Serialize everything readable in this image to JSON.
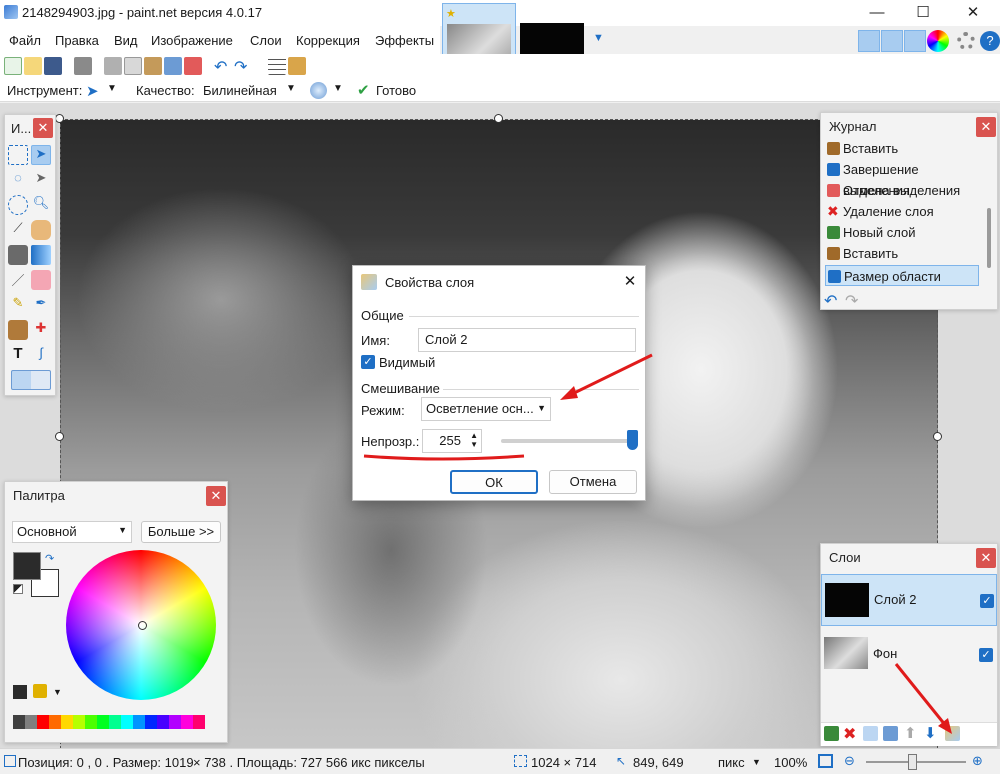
{
  "window": {
    "title": "2148294903.jpg - paint.net версия 4.0.17",
    "minimize": "—",
    "maximize": "☐",
    "close": "✕"
  },
  "menu": [
    "Файл",
    "Правка",
    "Вид",
    "Изображение",
    "Слои",
    "Коррекция",
    "Эффекты"
  ],
  "toolbar2": {
    "tool_label": "Инструмент:",
    "quality_label": "Качество:",
    "quality_value": "Билинейная",
    "done_label": "Готово"
  },
  "tools_panel": {
    "title": "И..."
  },
  "history": {
    "title": "Журнал",
    "items": [
      "Вставить",
      "Завершение выделения",
      "Отмена выделения",
      "Удаление слоя",
      "Новый слой",
      "Вставить",
      "Размер области"
    ],
    "selected_index": 6
  },
  "dialog": {
    "title": "Свойства слоя",
    "section_general": "Общие",
    "name_label": "Имя:",
    "name_value": "Слой 2",
    "visible_label": "Видимый",
    "section_blend": "Смешивание",
    "mode_label": "Режим:",
    "mode_value": "Осветление осн...",
    "opacity_label": "Непрозр.:",
    "opacity_value": "255",
    "ok_label": "ОК",
    "cancel_label": "Отмена"
  },
  "palette": {
    "title": "Палитра",
    "preset_value": "Основной",
    "more_label": "Больше >>",
    "primary_color": "#2b2b2b",
    "secondary_color": "#ffffff",
    "swatches": [
      "#404040",
      "#7f7f7f",
      "#ff0000",
      "#ff6a00",
      "#ffd800",
      "#b6ff00",
      "#4cff00",
      "#00ff21",
      "#00ff90",
      "#00ffff",
      "#0094ff",
      "#0026ff",
      "#4800ff",
      "#b200ff",
      "#ff00dc",
      "#ff006e"
    ]
  },
  "layers": {
    "title": "Слои",
    "items": [
      {
        "name": "Слой 2",
        "visible": true,
        "selected": true
      },
      {
        "name": "Фон",
        "visible": true,
        "selected": false
      }
    ]
  },
  "status": {
    "position": "Позиция: 0 , 0 . Размер: 1019 ",
    "size_rest": "× 738 . Площадь: 727 566 икс пикселы",
    "selection_size": "1024 × 714",
    "cursor_pos": "849, 649",
    "units": "пикс",
    "zoom": "100%"
  },
  "colors": {
    "accent": "#1f6fc5",
    "close_red": "#d9534f",
    "annotation_red": "#e01b1b",
    "selection_blue": "#cde4f7"
  }
}
